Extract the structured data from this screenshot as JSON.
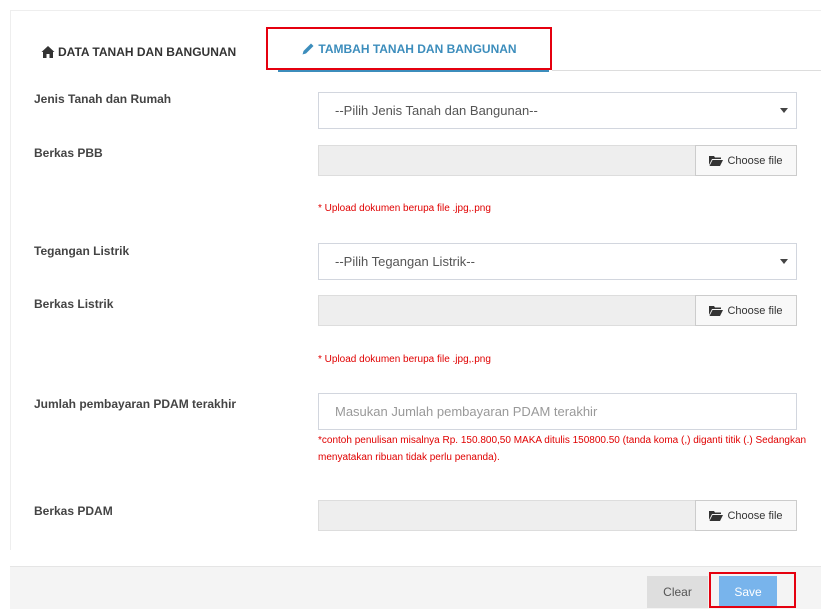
{
  "tabs": {
    "data_label": "DATA TANAH DAN BANGUNAN",
    "data_icon": "home-icon",
    "tambah_label": "TAMBAH TANAH DAN BANGUNAN",
    "tambah_icon": "pencil-icon"
  },
  "form": {
    "jenis": {
      "label": "Jenis Tanah dan Rumah",
      "selected": "--Pilih Jenis Tanah dan Bangunan--"
    },
    "berkas_pbb": {
      "label": "Berkas PBB",
      "button": "Choose file",
      "hint": "* Upload dokumen berupa file .jpg,.png"
    },
    "tegangan": {
      "label": "Tegangan Listrik",
      "selected": "--Pilih Tegangan Listrik--"
    },
    "berkas_listrik": {
      "label": "Berkas Listrik",
      "button": "Choose file",
      "hint": "* Upload dokumen berupa file .jpg,.png"
    },
    "pdam_jumlah": {
      "label": "Jumlah pembayaran PDAM terakhir",
      "placeholder": "Masukan Jumlah pembayaran PDAM terakhir",
      "note": "*contoh penulisan misalnya Rp. 150.800,50 MAKA ditulis 150800.50 (tanda koma (,) diganti titik (.) Sedangkan menyatakan ribuan tidak perlu penanda)."
    },
    "berkas_pdam": {
      "label": "Berkas PDAM",
      "button": "Choose file"
    }
  },
  "footer": {
    "clear": "Clear",
    "save": "Save"
  },
  "colors": {
    "accent": "#3c8dbc",
    "highlight": "#e5000f",
    "error": "#e00000",
    "save_bg": "#78b4ec"
  }
}
